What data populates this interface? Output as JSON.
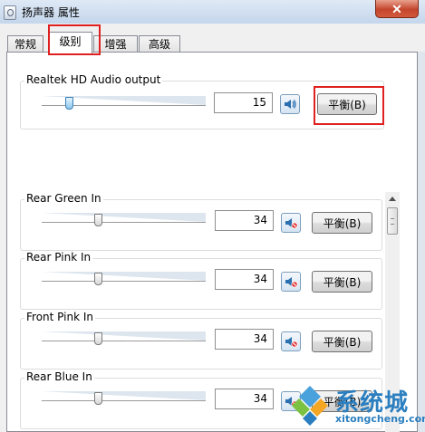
{
  "window": {
    "title": "扬声器 属性",
    "close_glyph": "✕"
  },
  "tabs": [
    {
      "label": "常规",
      "active": false
    },
    {
      "label": "级别",
      "active": true
    },
    {
      "label": "增强",
      "active": false
    },
    {
      "label": "高级",
      "active": false
    }
  ],
  "output": {
    "label": "Realtek HD Audio output",
    "value": "15",
    "level_percent": 15,
    "muted": false,
    "balance_label": "平衡(B)"
  },
  "inputs": [
    {
      "label": "Rear Green In",
      "value": "34",
      "level_percent": 34,
      "muted": true,
      "balance_label": "平衡(B)"
    },
    {
      "label": "Rear Pink In",
      "value": "34",
      "level_percent": 34,
      "muted": true,
      "balance_label": "平衡(B)"
    },
    {
      "label": "Front Pink In",
      "value": "34",
      "level_percent": 34,
      "muted": true,
      "balance_label": "平衡(B)"
    },
    {
      "label": "Rear Blue In",
      "value": "34",
      "level_percent": 34,
      "muted": true,
      "balance_label": "平衡(B)"
    }
  ],
  "watermark": {
    "text": "系统城",
    "url": "xitongcheng.com"
  },
  "colors": {
    "highlight": "#e02020",
    "slider_fill": "#dde6ef",
    "watermark": "#2b7fc0"
  }
}
